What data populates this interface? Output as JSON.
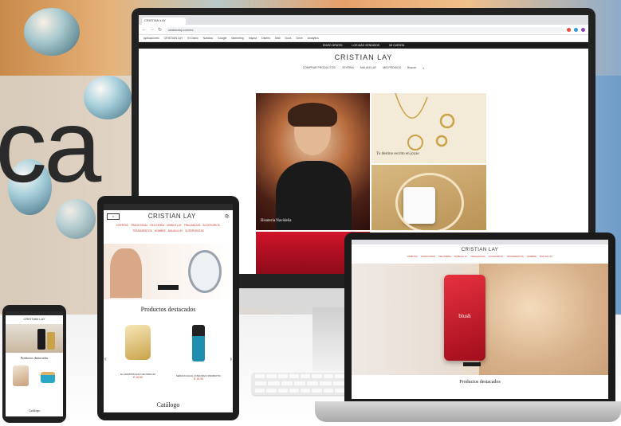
{
  "hero": {
    "word_fragment": "ca"
  },
  "desktop": {
    "browser_tab": "CRISTIAN LAY",
    "url": "cristianlay.com/es",
    "bookmarks": [
      "Aplicaciones",
      "CRISTIAN LAY",
      "El Diario",
      "Noticias",
      "Google",
      "Marketing",
      "Inspira",
      "Diseño",
      "Mail",
      "Docs",
      "Drive",
      "Analytics"
    ],
    "topbar": [
      "ENVÍO GRATIS",
      "LOS MÁS VENDIDOS",
      "MI CUENTA"
    ],
    "logo": "CRISTIAN LAY",
    "nav": [
      "COMPRAR PRODUCTOS",
      "JOYERÍA",
      "MALANI LAY",
      "MIS PEDIDOS",
      "Buscar"
    ],
    "tile_labels": [
      "Bisutería Navideña",
      "Tu destino escrito en joyas"
    ]
  },
  "tablet": {
    "logo": "CRISTIAN LAY",
    "nav": [
      "OFERTAS",
      "TRADICIONAL",
      "RELOJERÍA",
      "MOBILE LAY",
      "FRAGANCIAS",
      "ACCESORIOS",
      "TRATAMIENTOS",
      "HOMBRE",
      "MALANI LAY",
      "SUPERVENTAS"
    ],
    "section_title": "Productos destacados",
    "products": [
      {
        "name": "EL DIAMOND EAU DE PARFUM",
        "price": "€ 19,90"
      },
      {
        "name": "SERUM FACIAL INTENSIVO PROBIOTIC",
        "price": "€ 19,90"
      }
    ],
    "footer_title": "Catálogo"
  },
  "laptop": {
    "logo": "CRISTIAN LAY",
    "nav": [
      "OFERTAS",
      "TRADICIONAL",
      "RELOJERÍA",
      "MOBILE LAY",
      "FRAGANCIAS",
      "ACCESORIOS",
      "TRATAMIENTOS",
      "HOMBRE",
      "MALANI LAY"
    ],
    "perfume_label": "blush",
    "section_title": "Productos destacados"
  },
  "phone": {
    "logo": "CRISTIAN LAY",
    "section_title": "Productos destacados",
    "footer_title": "Catálogo"
  },
  "colors": {
    "brand_red": "#c0392b",
    "dark": "#1c1c1c",
    "gold": "#c9a24a"
  }
}
